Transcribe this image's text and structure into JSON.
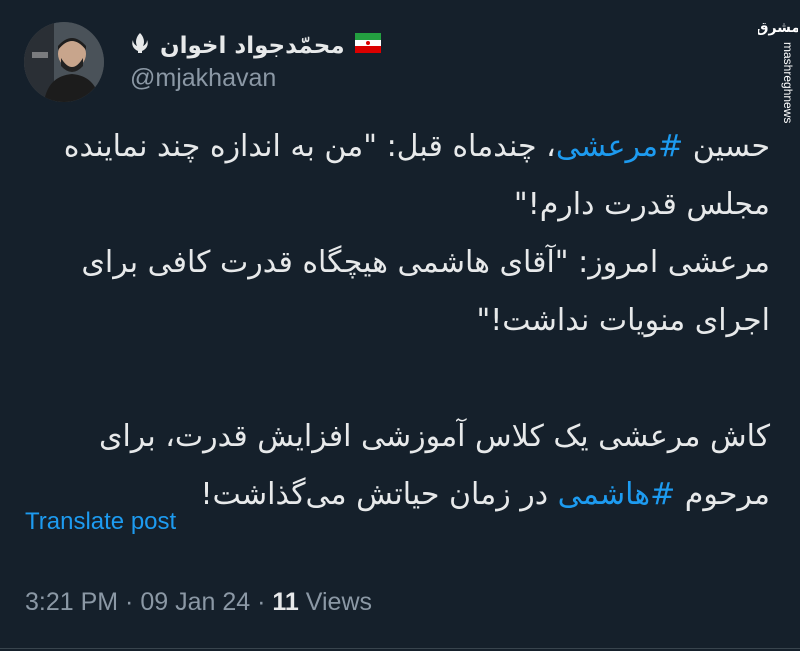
{
  "author": {
    "display_name": "محمّدجواد اخوان",
    "handle": "@mjakhavan",
    "flag_icon": "iran-flag-icon",
    "emblem_icon": "iran-emblem-icon"
  },
  "watermark": {
    "logo_text": "مشرق",
    "site": "mashreghnews.ir"
  },
  "tweet": {
    "line1_before": "حسین ",
    "line1_hashtag": "#مرعشی",
    "line1_after": "، چندماه قبل: \"من به اندازه چند نماینده",
    "line2": "مجلس قدرت دارم!\"",
    "line3": "مرعشی امروز: \"آقای هاشمی هیچگاه قدرت کافی برای",
    "line4": "اجرای منویات نداشت!\"",
    "line5": "کاش مرعشی یک کلاس آموزشی افزایش قدرت، برای",
    "line6_before": "مرحوم ",
    "line6_hashtag": "#هاشمی",
    "line6_after": " در زمان حیاتش می‌گذاشت!"
  },
  "translate_label": "Translate post",
  "meta": {
    "time": "3:21 PM",
    "separator": " · ",
    "date": "09 Jan 24",
    "views_count": "11",
    "views_label": "Views"
  },
  "colors": {
    "background": "#15202b",
    "text": "#e7e9ea",
    "secondary": "#8b98a5",
    "link": "#1d9bf0"
  }
}
